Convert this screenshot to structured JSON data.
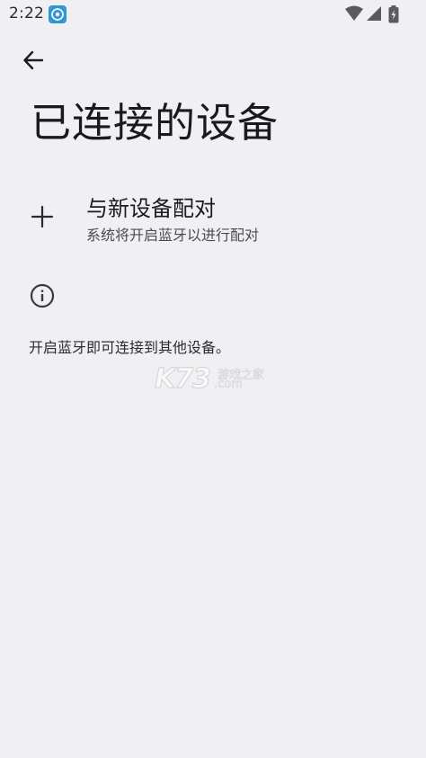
{
  "status_bar": {
    "time": "2:22",
    "notification_icon": "settings-gear-app-icon",
    "wifi_icon": "wifi-icon",
    "signal_icon": "cell-signal-icon",
    "battery_icon": "battery-icon"
  },
  "header": {
    "back_icon": "arrow-left-icon",
    "title": "已连接的设备"
  },
  "pair_new": {
    "icon": "plus-icon",
    "title": "与新设备配对",
    "subtitle": "系统将开启蓝牙以进行配对"
  },
  "info": {
    "icon": "info-icon",
    "text": "开启蓝牙即可连接到其他设备。"
  },
  "watermark": {
    "logo": "K73",
    "site": "游戏之家",
    "domain": ".com"
  },
  "colors": {
    "background": "#f0f0f3",
    "text_primary": "#1c1c1e",
    "text_secondary": "#4a4a50",
    "notif_icon_bg": "#2f96d8"
  }
}
